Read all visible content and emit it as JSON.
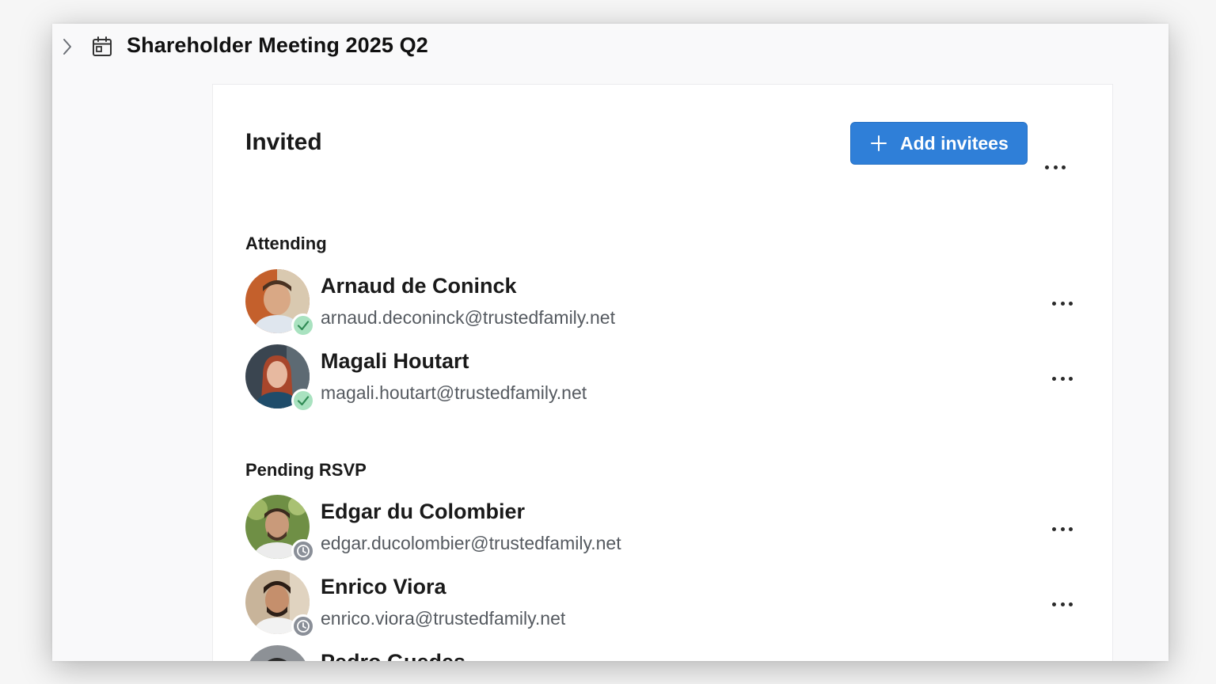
{
  "header": {
    "title": "Shareholder Meeting 2025 Q2"
  },
  "panel": {
    "heading": "Invited",
    "add_button_label": "Add invitees"
  },
  "sections": {
    "attending": {
      "label": "Attending",
      "people": [
        {
          "name": "Arnaud de Coninck",
          "email": "arnaud.deconinck@trustedfamily.net",
          "status": "accepted"
        },
        {
          "name": "Magali Houtart",
          "email": "magali.houtart@trustedfamily.net",
          "status": "accepted"
        }
      ]
    },
    "pending": {
      "label": "Pending RSVP",
      "people": [
        {
          "name": "Edgar du Colombier",
          "email": "edgar.ducolombier@trustedfamily.net",
          "status": "pending"
        },
        {
          "name": "Enrico Viora",
          "email": "enrico.viora@trustedfamily.net",
          "status": "pending"
        },
        {
          "name": "Pedro Guedes",
          "email": "",
          "status": "pending"
        }
      ]
    }
  },
  "colors": {
    "primary_button": "#2f7fd8",
    "accepted_badge": "#a9e2c0",
    "pending_badge": "#8a8f98"
  },
  "icons": {
    "expand": "chevron-right-icon",
    "meeting": "calendar-icon",
    "add": "plus-icon",
    "more": "more-horizontal-icon",
    "accepted": "check-icon",
    "pending": "clock-icon"
  }
}
